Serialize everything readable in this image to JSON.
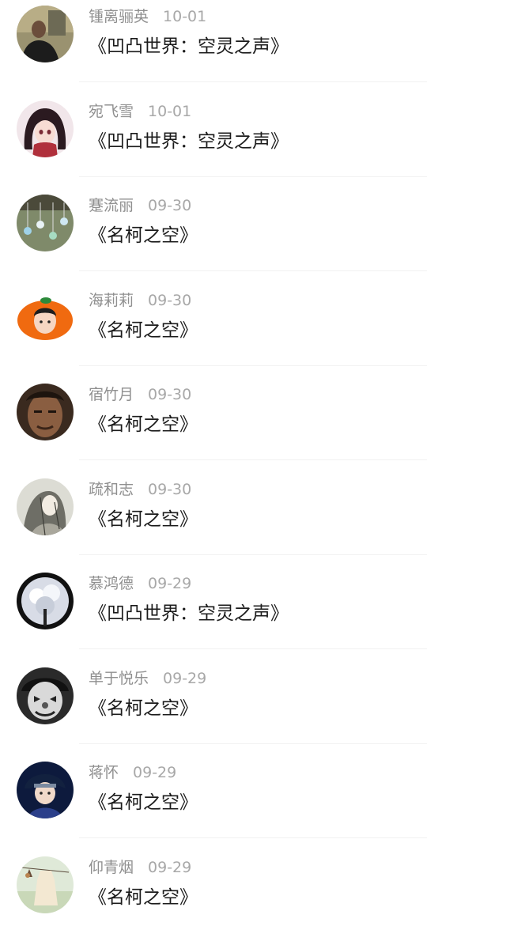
{
  "comments": [
    {
      "name": "锺离骊英",
      "date": "10-01",
      "title": "《凹凸世界：空灵之声》",
      "avatar_icon": "man-dark-shirt-avatar-icon"
    },
    {
      "name": "宛飞雪",
      "date": "10-01",
      "title": "《凹凸世界：空灵之声》",
      "avatar_icon": "anime-girl-avatar-icon"
    },
    {
      "name": "蹇流丽",
      "date": "09-30",
      "title": "《名柯之空》",
      "avatar_icon": "wind-chimes-avatar-icon"
    },
    {
      "name": "海莉莉",
      "date": "09-30",
      "title": "《名柯之空》",
      "avatar_icon": "orange-boy-avatar-icon"
    },
    {
      "name": "宿竹月",
      "date": "09-30",
      "title": "《名柯之空》",
      "avatar_icon": "man-face-avatar-icon"
    },
    {
      "name": "疏和志",
      "date": "09-30",
      "title": "《名柯之空》",
      "avatar_icon": "sketch-girl-avatar-icon"
    },
    {
      "name": "慕鸿德",
      "date": "09-29",
      "title": "《凹凸世界：空灵之声》",
      "avatar_icon": "snow-tree-avatar-icon"
    },
    {
      "name": "单于悦乐",
      "date": "09-29",
      "title": "《名柯之空》",
      "avatar_icon": "clown-avatar-icon"
    },
    {
      "name": "蒋怀",
      "date": "09-29",
      "title": "《名柯之空》",
      "avatar_icon": "anime-ninja-avatar-icon"
    },
    {
      "name": "仰青烟",
      "date": "09-29",
      "title": "《名柯之空》",
      "avatar_icon": "hanging-dress-avatar-icon"
    }
  ]
}
